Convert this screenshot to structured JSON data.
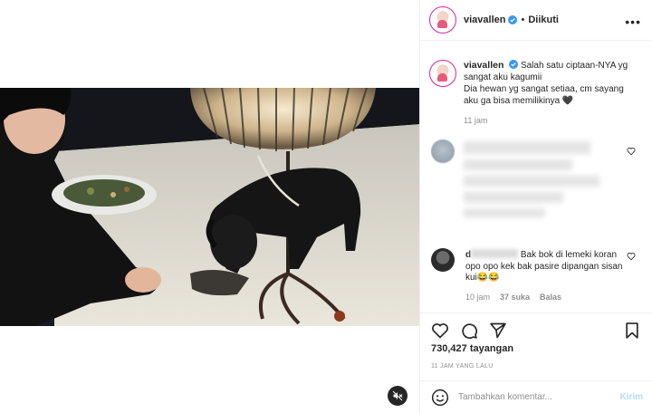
{
  "header": {
    "username": "viavallen",
    "separator": "•",
    "follow_status": "Diikuti",
    "more_icon": "more-dots-icon"
  },
  "caption": {
    "username": "viavallen",
    "text_line1": "Salah satu ciptaan-NYA yg sangat aku kagumii",
    "text_line2": "Dia hewan yg sangat setiaa, cm sayang aku ga bisa memilikinya 🖤",
    "time": "11 jam"
  },
  "comments": [
    {
      "username_prefix": "d",
      "text": "Bak bok di lemeki koran opo opo kek bak pasire dipangan sisan kui😂😂",
      "time": "10 jam",
      "likes": "37 suka",
      "reply": "Balas"
    }
  ],
  "stats": {
    "views": "730,427 tayangan",
    "posted": "11 JAM YANG LALU"
  },
  "add_comment": {
    "placeholder": "Tambahkan komentar...",
    "post_label": "Kirim"
  },
  "colors": {
    "verified": "#3897f0",
    "post_disabled": "#b3dbff",
    "muted_text": "#8e8e8e"
  }
}
